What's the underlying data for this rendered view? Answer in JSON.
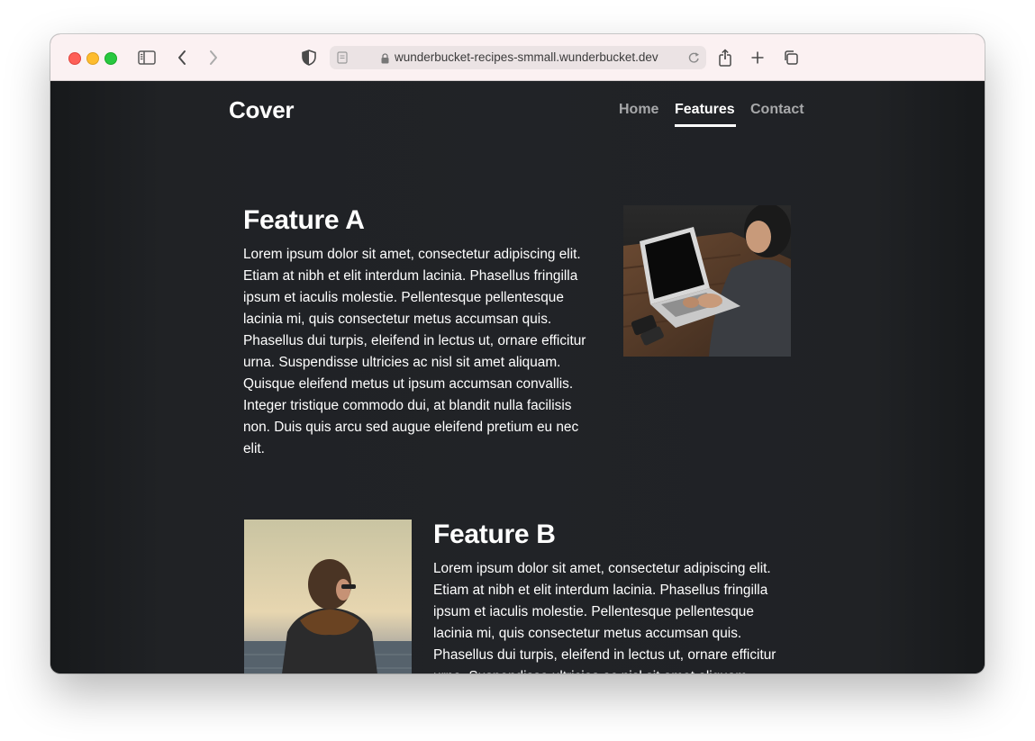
{
  "browser": {
    "url": "wunderbucket-recipes-smmall.wunderbucket.dev"
  },
  "site": {
    "brand": "Cover",
    "nav": {
      "home": "Home",
      "features": "Features",
      "contact": "Contact",
      "active": "Features"
    }
  },
  "features": [
    {
      "title": "Feature A",
      "body": "Lorem ipsum dolor sit amet, consectetur adipiscing elit. Etiam at nibh et elit interdum lacinia. Phasellus fringilla ipsum et iaculis molestie. Pellentesque pellentesque lacinia mi, quis consectetur metus accumsan quis. Phasellus dui turpis, eleifend in lectus ut, ornare efficitur urna. Suspendisse ultricies ac nisl sit amet aliquam. Quisque eleifend metus ut ipsum accumsan convallis. Integer tristique commodo dui, at blandit nulla facilisis non. Duis quis arcu sed augue eleifend pretium eu nec elit.",
      "image": "person-typing-on-laptop-photo"
    },
    {
      "title": "Feature B",
      "body": "Lorem ipsum dolor sit amet, consectetur adipiscing elit. Etiam at nibh et elit interdum lacinia. Phasellus fringilla ipsum et iaculis molestie. Pellentesque pellentesque lacinia mi, quis consectetur metus accumsan quis. Phasellus dui turpis, eleifend in lectus ut, ornare efficitur urna. Suspendisse ultricies ac nisl sit amet aliquam. Quisque eleifend metus ut ipsum",
      "image": "person-at-seaside-photo"
    }
  ],
  "colors": {
    "page_bg": "#212327",
    "nav_inactive": "#a7a8aa",
    "text": "#ffffff"
  }
}
